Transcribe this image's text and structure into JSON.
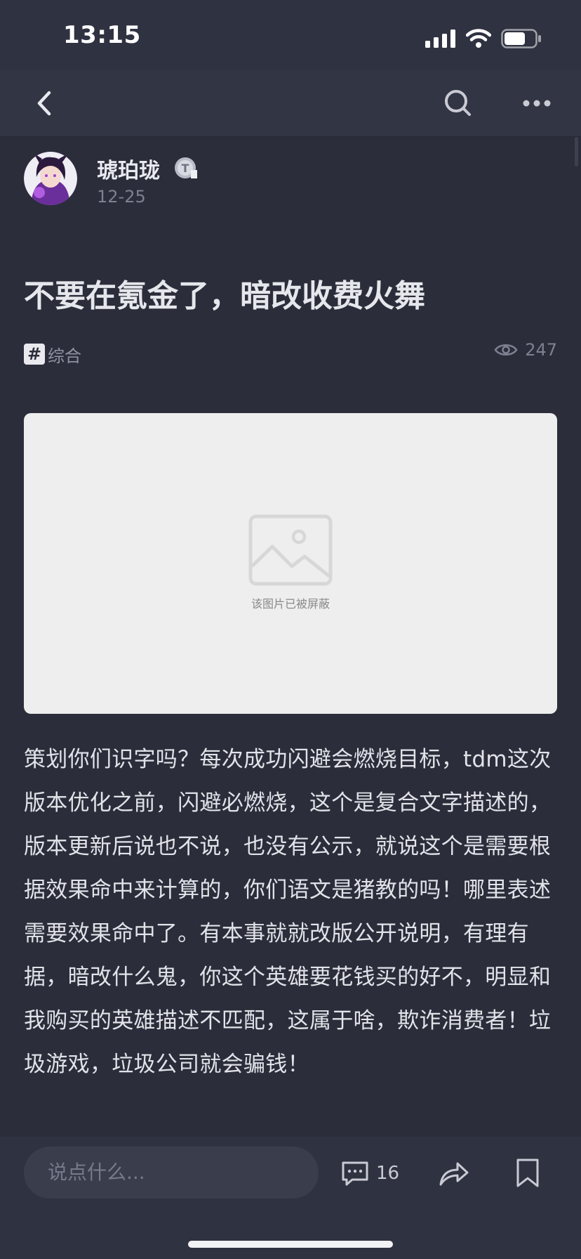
{
  "status": {
    "time": "13:15"
  },
  "nav": {
    "back_icon": "chevron-left-icon",
    "search_icon": "search-icon",
    "more_icon": "more-dots-icon"
  },
  "author": {
    "name": "琥珀珑",
    "date": "12-25",
    "badge_letter": "T"
  },
  "post": {
    "title": "不要在氪金了，暗改收费火舞",
    "tag_symbol": "#",
    "tag": "综合",
    "views": "247",
    "image_blocked_text": "该图片已被屏蔽",
    "body": "策划你们识字吗？每次成功闪避会燃烧目标，tdm这次版本优化之前，闪避必燃烧，这个是复合文字描述的，版本更新后说也不说，也没有公示，就说这个是需要根据效果命中来计算的，你们语文是猪教的吗！哪里表述需要效果命中了。有本事就就改版公开说明，有理有据，暗改什么鬼，你这个英雄要花钱买的好不，明显和我购买的英雄描述不匹配，这属于啥，欺诈消费者！垃圾游戏，垃圾公司就会骗钱！"
  },
  "bottom": {
    "comment_placeholder": "说点什么...",
    "comment_count": "16"
  },
  "colors": {
    "background": "#2b2d3a",
    "nav": "#323543",
    "image_placeholder": "#eeeeee"
  }
}
